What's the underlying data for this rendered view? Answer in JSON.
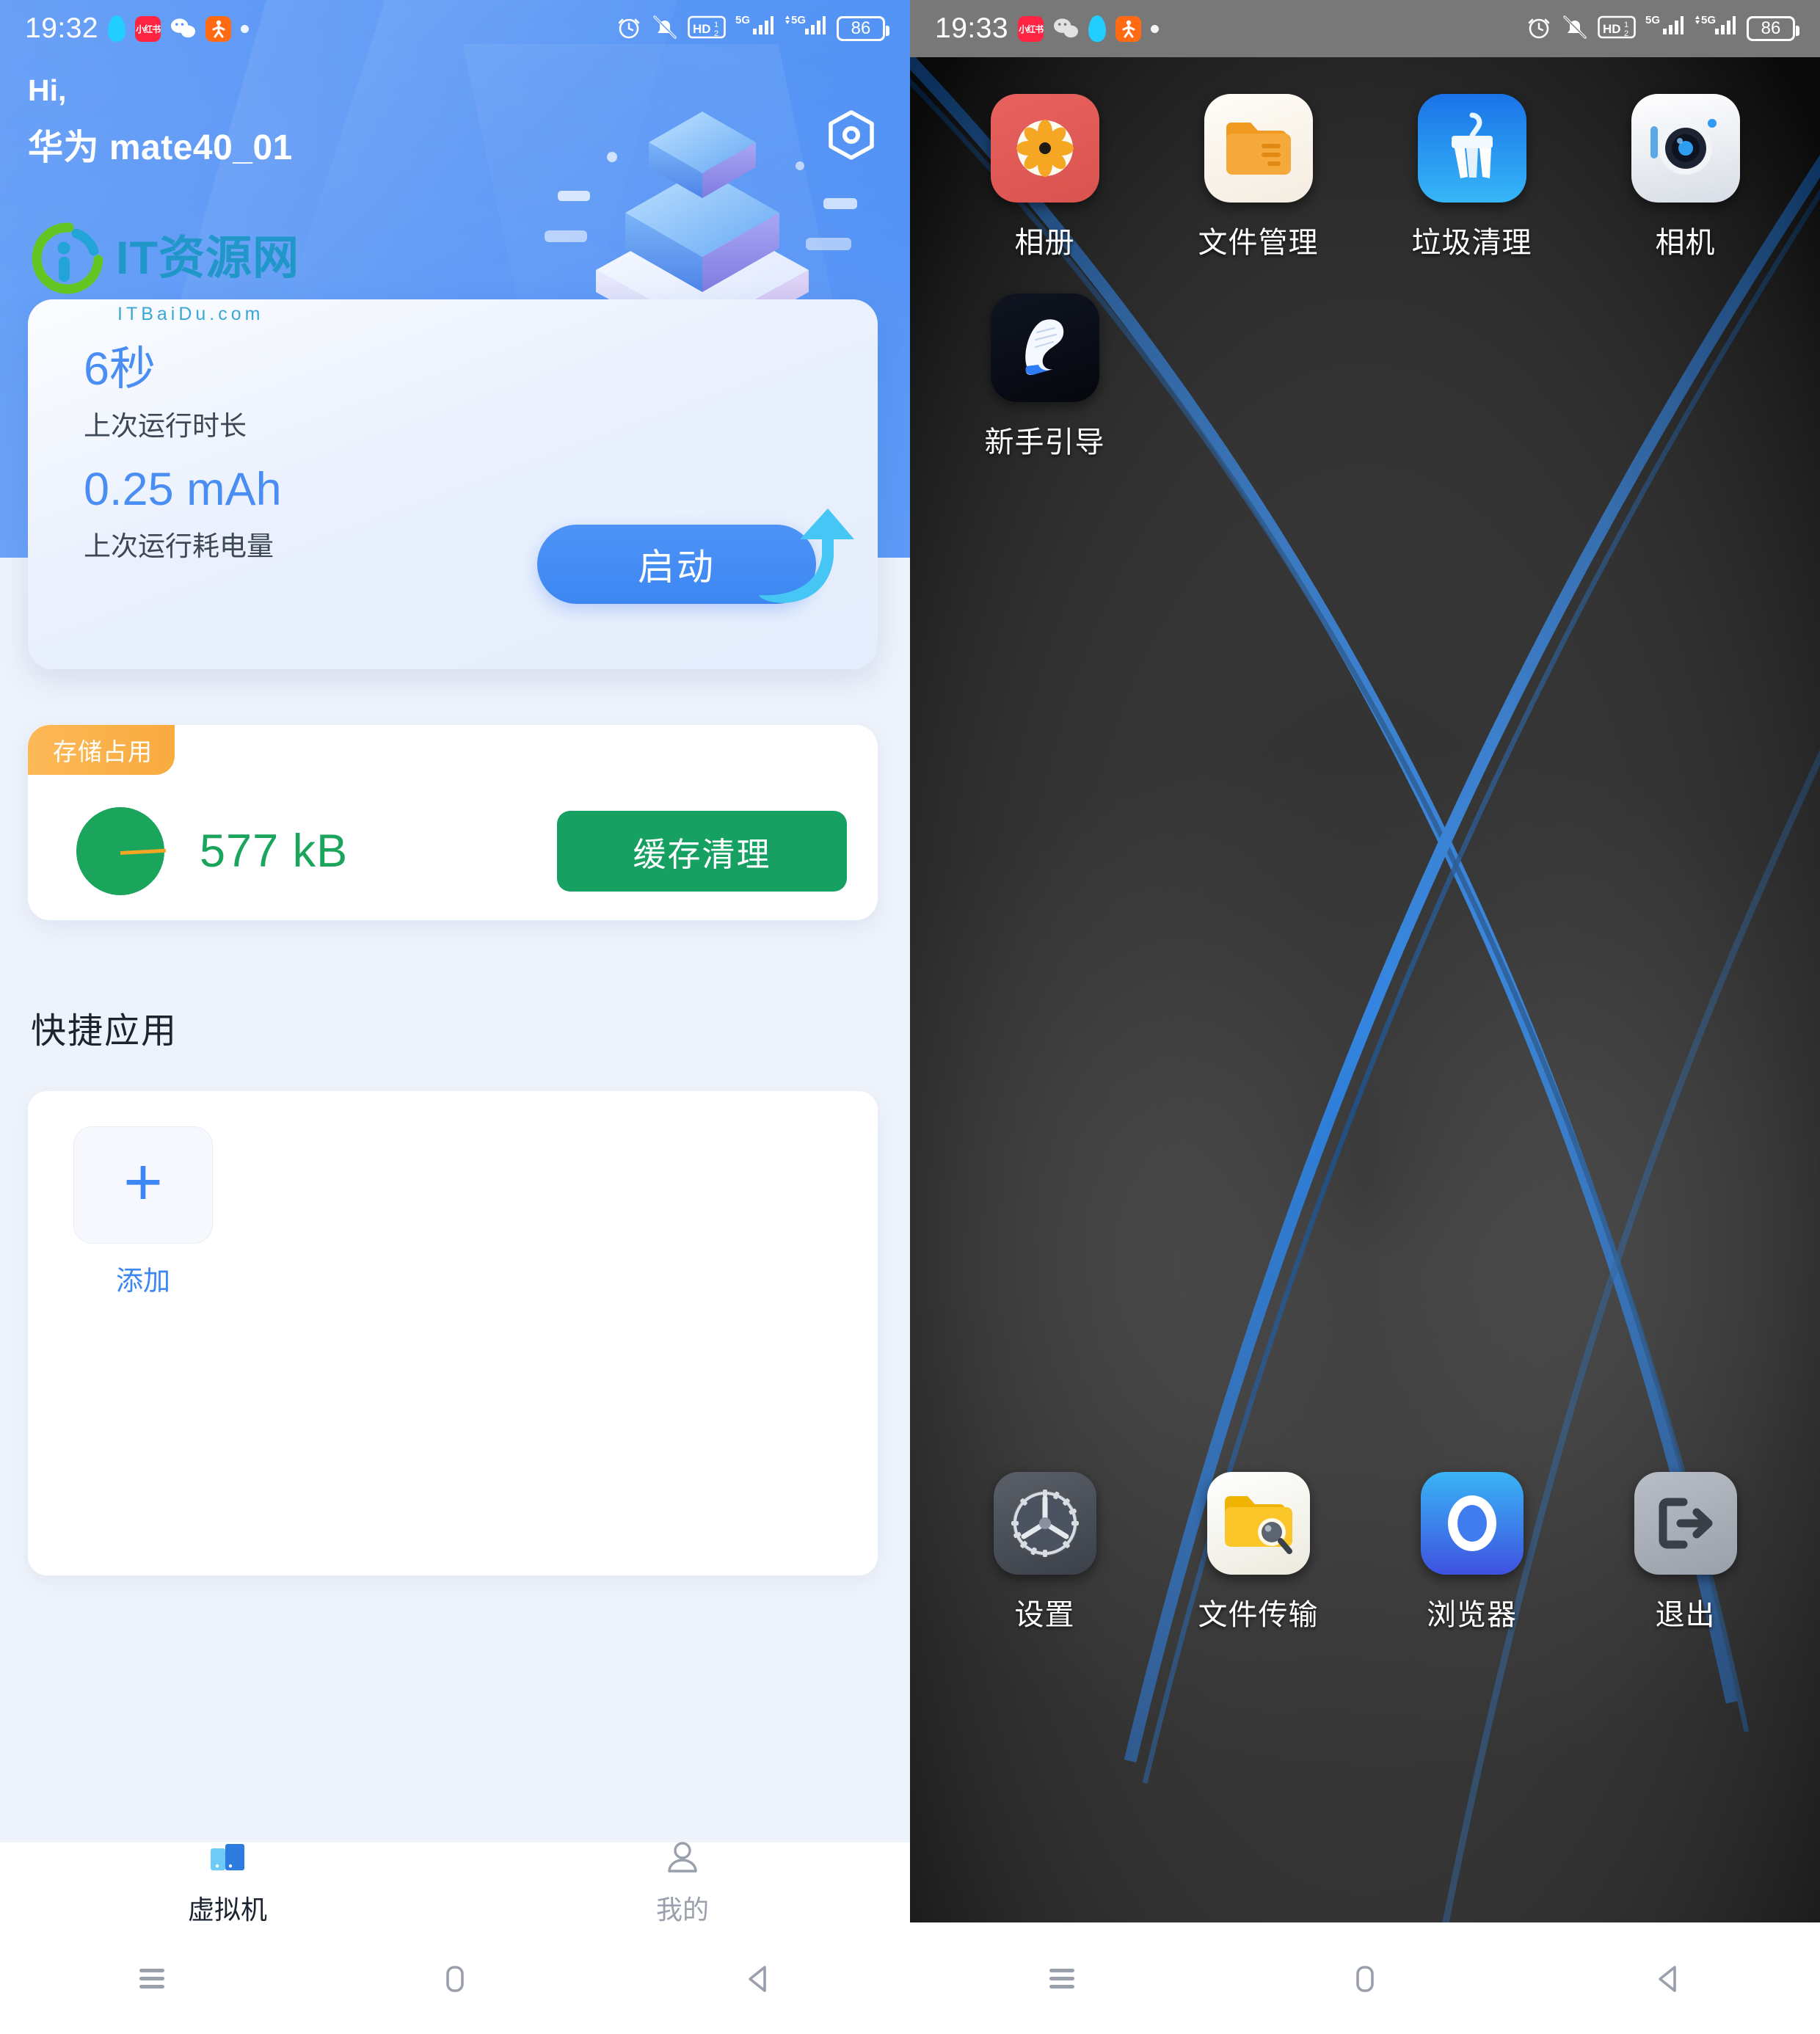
{
  "left": {
    "status_bar": {
      "time": "19:32",
      "battery": "86",
      "network_label": "5G",
      "hd_label": "HD",
      "icons": [
        "qq-icon",
        "xiaohongshu-icon",
        "wechat-icon",
        "sport-icon",
        "more-dot-icon",
        "alarm-icon",
        "mute-icon",
        "hd-volte-icon",
        "signal-sim1-icon",
        "signal-sim2-icon",
        "battery-icon"
      ],
      "xhs_text": "小红书"
    },
    "greeting": {
      "hi": "Hi,",
      "device": "华为 mate40_01"
    },
    "watermark": {
      "title": "IT资源网",
      "subtitle": "ITBaiDu.com"
    },
    "stat_card": {
      "runtime_value": "6秒",
      "runtime_label": "上次运行时长",
      "power_value": "0.25 mAh",
      "power_label": "上次运行耗电量",
      "launch_button": "启动"
    },
    "storage_card": {
      "badge": "存储占用",
      "size": "577 kB",
      "clean_button": "缓存清理",
      "used_color": "#1aa45c",
      "free_color": "#f5a623"
    },
    "quick_apps": {
      "title": "快捷应用",
      "add_label": "添加"
    },
    "tabs": [
      {
        "label": "虚拟机",
        "icon": "virtual-machine-icon",
        "active": true
      },
      {
        "label": "我的",
        "icon": "person-icon",
        "active": false
      }
    ]
  },
  "right": {
    "status_bar": {
      "time": "19:33",
      "battery": "86",
      "xhs_text": "小红书"
    },
    "home_apps": [
      {
        "label": "相册",
        "icon": "gallery-icon"
      },
      {
        "label": "文件管理",
        "icon": "file-manager-icon"
      },
      {
        "label": "垃圾清理",
        "icon": "junk-clean-icon"
      },
      {
        "label": "相机",
        "icon": "camera-icon"
      },
      {
        "label": "新手引导",
        "icon": "beginner-guide-icon"
      }
    ],
    "dock_apps": [
      {
        "label": "设置",
        "icon": "settings-gear-icon"
      },
      {
        "label": "文件传输",
        "icon": "file-transfer-icon"
      },
      {
        "label": "浏览器",
        "icon": "browser-icon"
      },
      {
        "label": "退出",
        "icon": "exit-icon"
      }
    ]
  },
  "nav_bar": {
    "recents": "recents-icon",
    "home": "home-icon",
    "back": "back-icon"
  },
  "colors": {
    "accent_blue": "#3d87f2",
    "green": "#16a163",
    "orange": "#f9ab3f",
    "hero_blue": "#5b97f6"
  }
}
